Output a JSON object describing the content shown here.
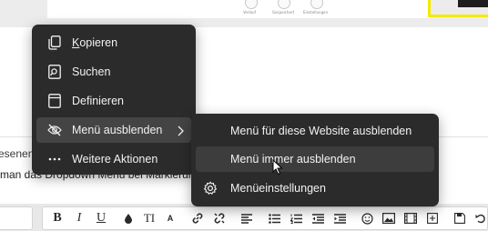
{
  "background": {
    "icon_labels": [
      "Verlauf",
      "Gespeichert",
      "Einstellungen"
    ],
    "partial_text_1": "esenen",
    "partial_text_2": "man das Dropdown Menü bei Markierun"
  },
  "context_menu": {
    "items": [
      {
        "label": "Kopieren",
        "icon": "copy-icon",
        "accelerator_letter": "K",
        "rest": "opieren"
      },
      {
        "label": "Suchen",
        "icon": "search-icon"
      },
      {
        "label": "Definieren",
        "icon": "book-icon"
      },
      {
        "label": "Menü ausblenden",
        "icon": "eye-off-icon",
        "has_submenu": true
      },
      {
        "label": "Weitere Aktionen",
        "icon": "more-icon"
      }
    ]
  },
  "submenu": {
    "items": [
      {
        "label": "Menü für diese Website ausblenden"
      },
      {
        "label": "Menü immer ausblenden"
      },
      {
        "label": "Menüeinstellungen",
        "icon": "gear-icon"
      }
    ]
  },
  "toolbar": {
    "bold": "B",
    "italic": "I",
    "underline": "U",
    "text_size": "TI",
    "text_size_sub": "A"
  },
  "colors": {
    "menu_bg": "#2b2b2b",
    "menu_text": "#f2f2f2",
    "highlight_yellow": "#f4ea00"
  }
}
